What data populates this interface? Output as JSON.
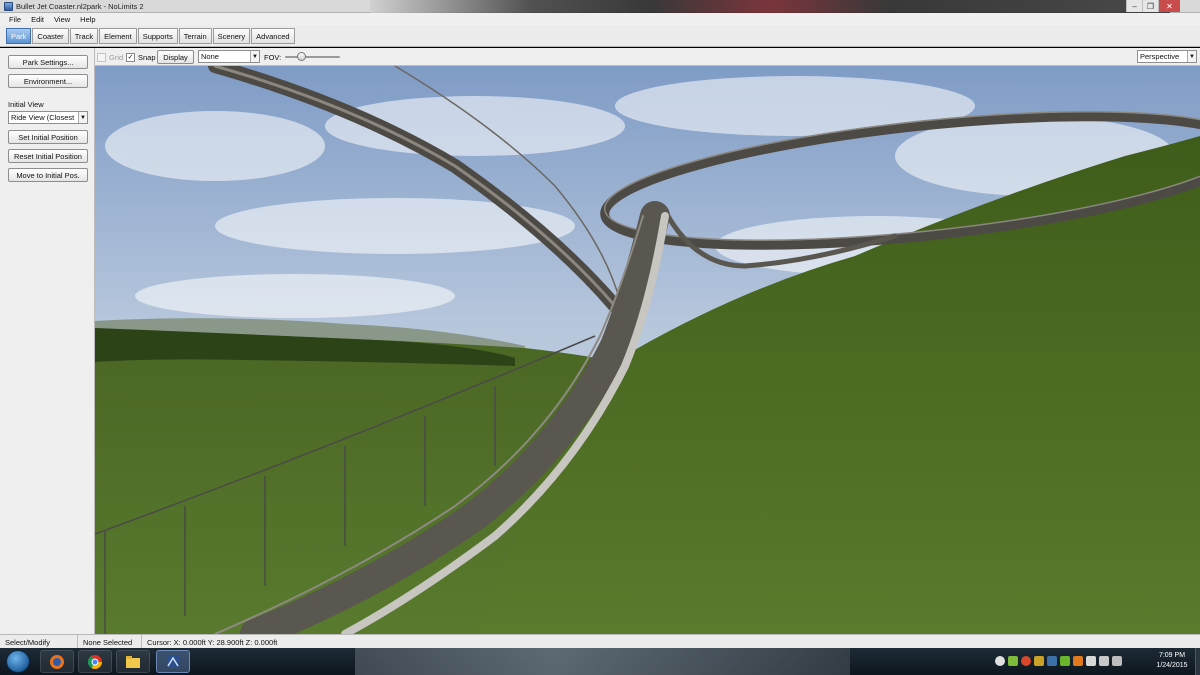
{
  "window": {
    "title": "Bullet Jet Coaster.nl2park - NoLimits 2",
    "minimize_label": "–",
    "maximize_label": "❐",
    "close_label": "✕"
  },
  "menu": [
    "File",
    "Edit",
    "View",
    "Help"
  ],
  "tabs": [
    {
      "label": "Park",
      "active": true
    },
    {
      "label": "Coaster",
      "active": false
    },
    {
      "label": "Track",
      "active": false
    },
    {
      "label": "Element",
      "active": false
    },
    {
      "label": "Supports",
      "active": false
    },
    {
      "label": "Terrain",
      "active": false
    },
    {
      "label": "Scenery",
      "active": false
    },
    {
      "label": "Advanced",
      "active": false
    }
  ],
  "left_panel": {
    "park_settings": "Park Settings...",
    "environment": "Environment...",
    "initial_view_label": "Initial View",
    "initial_view_value": "Ride View (Closest",
    "set_initial_position": "Set Initial Position",
    "reset_initial_position": "Reset Initial Position",
    "move_to_initial_pos": "Move to Initial Pos."
  },
  "toolbar": {
    "grid_label": "Grid",
    "grid_checked": false,
    "snap_label": "Snap",
    "snap_checked": true,
    "display_button": "Display",
    "display_select": "None",
    "fov_label": "FOV:",
    "projection": "Perspective"
  },
  "status": {
    "mode": "Select/Modify",
    "selection": "None Selected",
    "cursor": "Cursor: X: 0.000ft Y: 28.900ft Z: 0.000ft"
  },
  "taskbar": {
    "apps": [
      {
        "name": "firefox-icon",
        "active": false
      },
      {
        "name": "chrome-icon",
        "active": false
      },
      {
        "name": "file-explorer-icon",
        "active": false
      },
      {
        "name": "nolimits-icon",
        "active": true
      }
    ],
    "clock_time": "7:09 PM",
    "clock_date": "1/24/2015"
  },
  "colors": {
    "tab_active": "#5b93d3",
    "sky_top": "#7f9cc6",
    "grass": "#4b6b22",
    "track": "#5a5650"
  }
}
